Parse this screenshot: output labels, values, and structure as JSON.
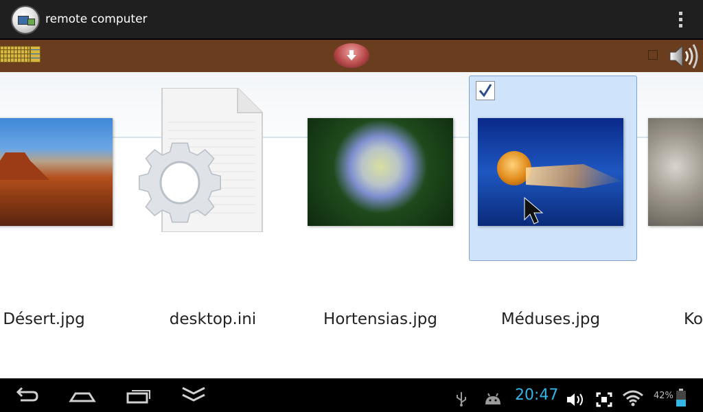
{
  "titlebar": {
    "title": "remote computer",
    "app_icon": "remote-desktop-icon",
    "overflow_icon": "overflow-menu-icon"
  },
  "toolbar": {
    "keyboard_icon": "keyboard-icon",
    "download_icon": "download-arrow-icon",
    "speaker_icon": "speaker-icon"
  },
  "explorer": {
    "files": [
      {
        "name": "Désert.jpg",
        "icon": "image-thumbnail"
      },
      {
        "name": "desktop.ini",
        "icon": "settings-file-icon"
      },
      {
        "name": "Hortensias.jpg",
        "icon": "image-thumbnail"
      },
      {
        "name": "Méduses.jpg",
        "icon": "image-thumbnail",
        "selected": true,
        "checked": true
      },
      {
        "name": "Ko",
        "icon": "image-thumbnail"
      }
    ]
  },
  "statusbar": {
    "time": "20:47",
    "battery": "42%",
    "icons": [
      "back-icon",
      "home-icon",
      "recent-apps-icon",
      "hide-keyboard-icon",
      "usb-icon",
      "android-debug-icon",
      "volume-icon",
      "screenshot-icon",
      "wifi-icon",
      "battery-icon"
    ]
  },
  "colors": {
    "toolbar_brown": "#6a3d1e",
    "selection": "#cfe3fb",
    "clock": "#33b5e5"
  }
}
